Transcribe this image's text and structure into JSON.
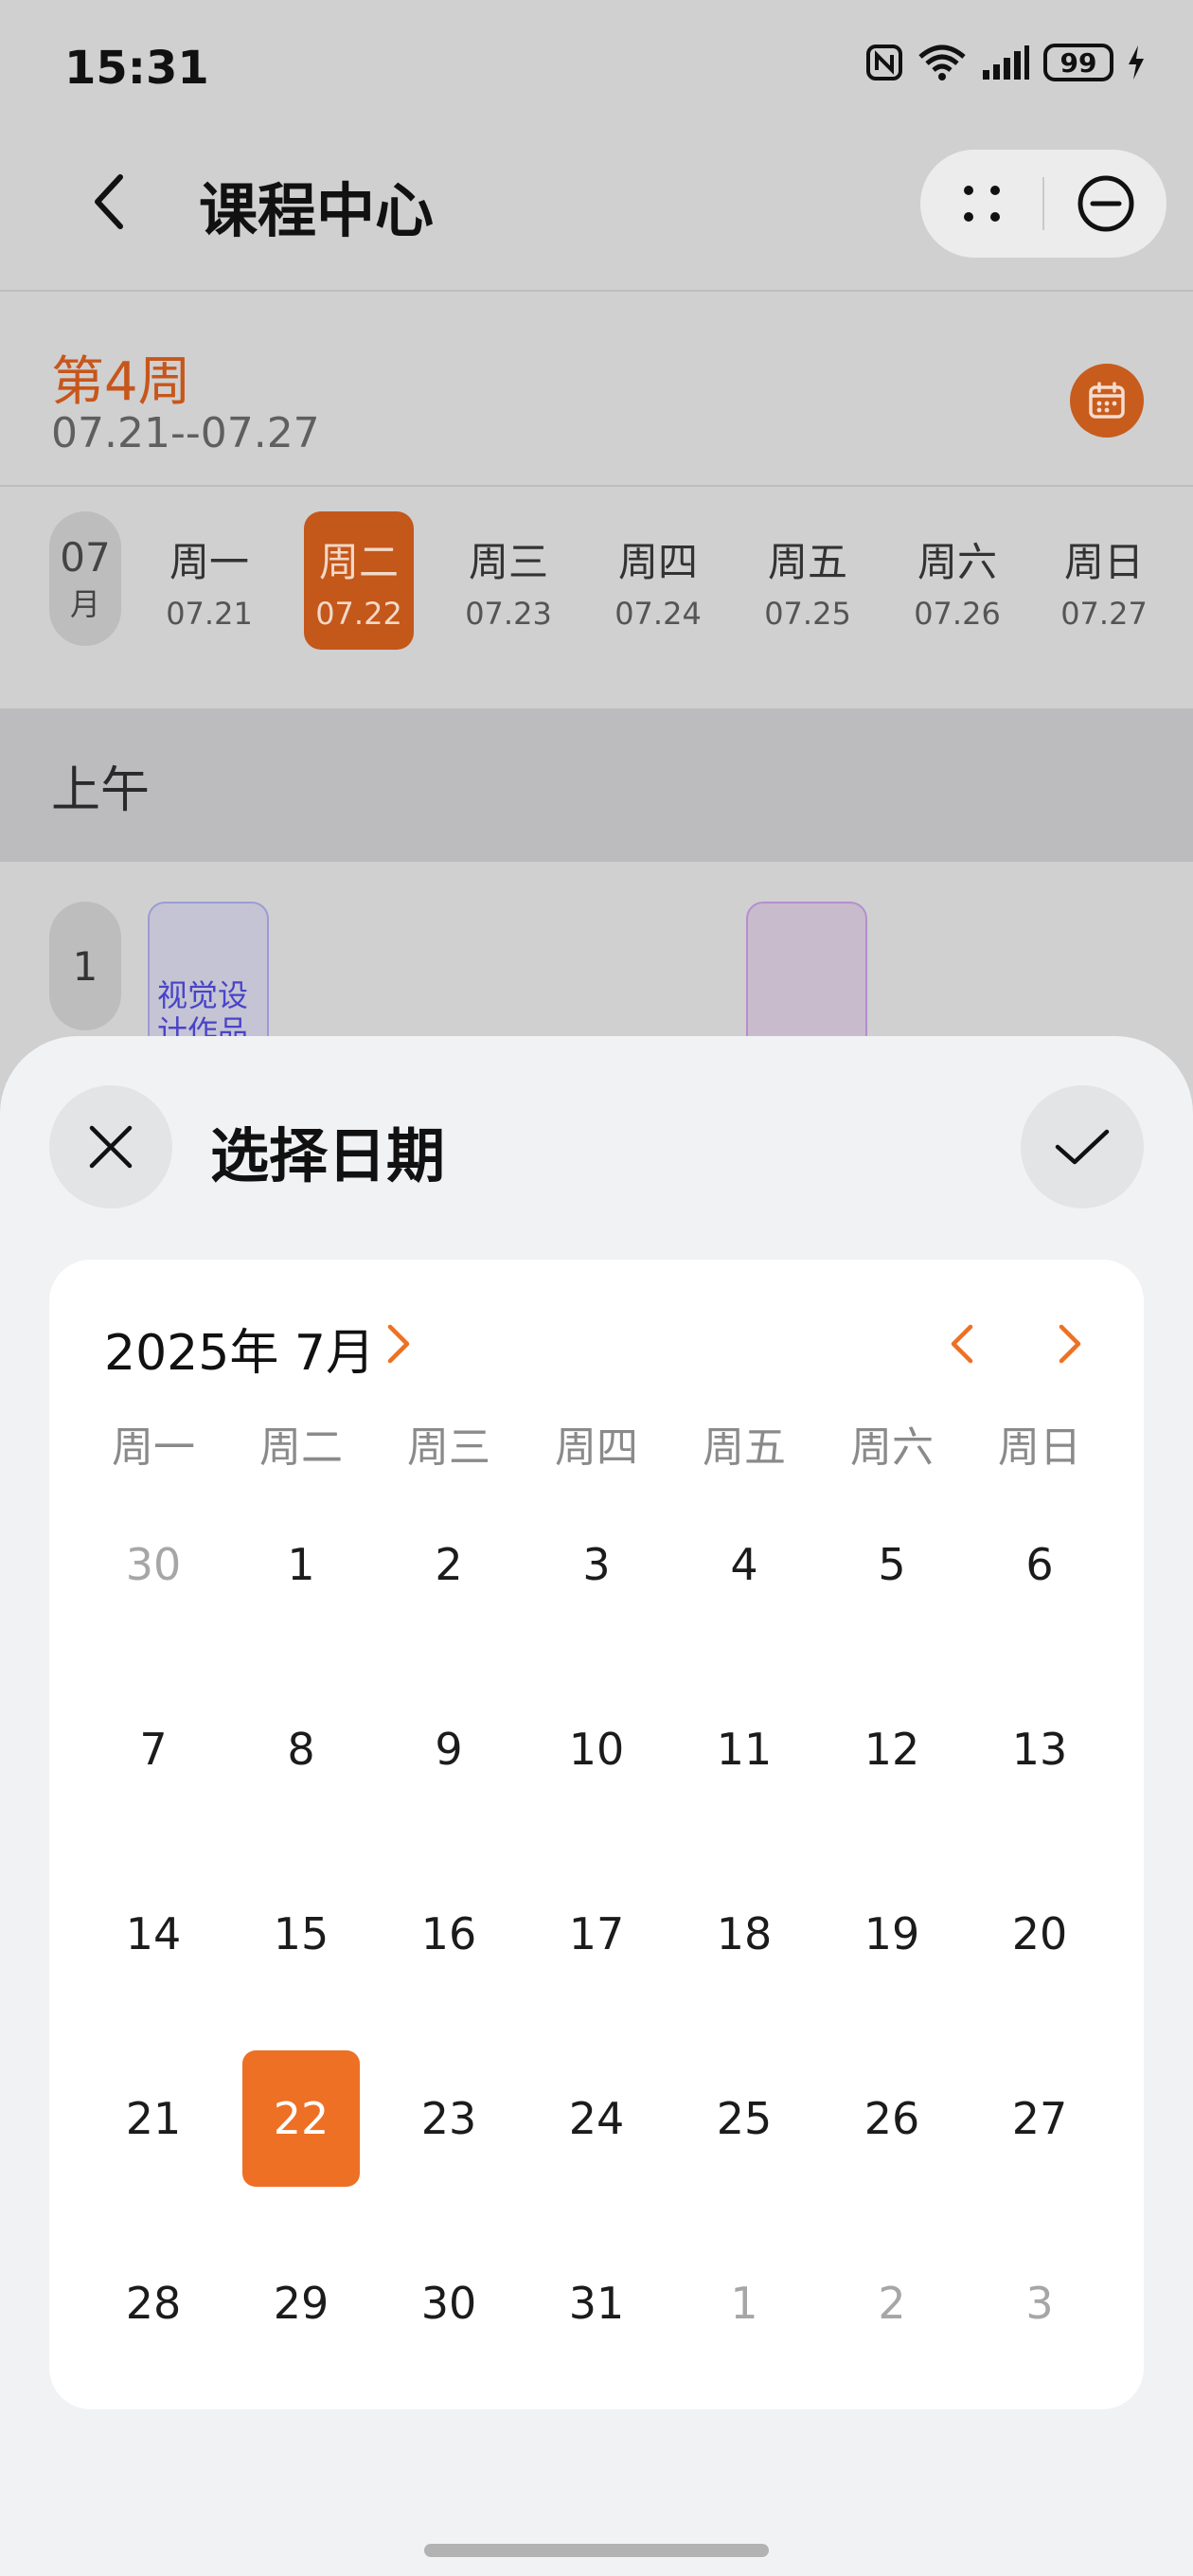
{
  "status_bar": {
    "time": "15:31",
    "battery": "99",
    "icons": [
      "nfc-icon",
      "wifi-icon",
      "signal-icon",
      "battery-icon",
      "charging-icon"
    ]
  },
  "header": {
    "title": "课程中心",
    "back_icon": "chevron-left-icon",
    "more_icon": "more-dots-icon",
    "close_icon": "minus-circle-icon"
  },
  "week": {
    "label": "第4周",
    "range": "07.21--07.27",
    "calendar_icon": "calendar-icon"
  },
  "week_strip": {
    "month": "07",
    "month_unit": "月",
    "days": [
      {
        "weekday": "周一",
        "date": "07.21"
      },
      {
        "weekday": "周二",
        "date": "07.22"
      },
      {
        "weekday": "周三",
        "date": "07.23"
      },
      {
        "weekday": "周四",
        "date": "07.24"
      },
      {
        "weekday": "周五",
        "date": "07.25"
      },
      {
        "weekday": "周六",
        "date": "07.26"
      },
      {
        "weekday": "周日",
        "date": "07.27"
      }
    ],
    "selected_index": 1
  },
  "schedule": {
    "section": "上午",
    "period": "1",
    "course_1": "视觉设计作品"
  },
  "date_picker": {
    "title": "选择日期",
    "month_title": "2025年 7月",
    "weekdays": [
      "周一",
      "周二",
      "周三",
      "周四",
      "周五",
      "周六",
      "周日"
    ],
    "weeks": [
      [
        "30",
        "1",
        "2",
        "3",
        "4",
        "5",
        "6"
      ],
      [
        "7",
        "8",
        "9",
        "10",
        "11",
        "12",
        "13"
      ],
      [
        "14",
        "15",
        "16",
        "17",
        "18",
        "19",
        "20"
      ],
      [
        "21",
        "22",
        "23",
        "24",
        "25",
        "26",
        "27"
      ],
      [
        "28",
        "29",
        "30",
        "31",
        "1",
        "2",
        "3"
      ]
    ],
    "muted_cells": [
      [
        0,
        0
      ],
      [
        4,
        4
      ],
      [
        4,
        5
      ],
      [
        4,
        6
      ]
    ],
    "selected_cell": [
      3,
      1
    ],
    "accent_color": "#EE7024"
  }
}
